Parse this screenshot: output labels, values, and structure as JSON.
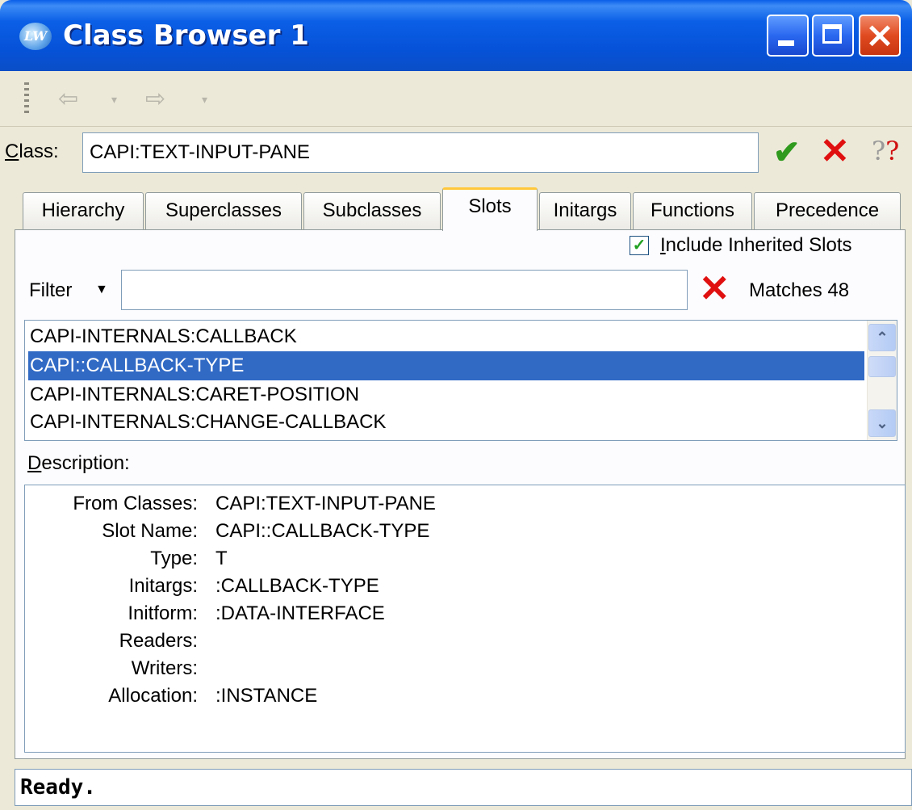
{
  "window": {
    "title": "Class Browser 1",
    "app_icon": "lw-icon",
    "controls": {
      "minimize": "minimize-icon",
      "maximize": "maximize-icon",
      "close": "close-icon"
    }
  },
  "toolbar": {
    "back": "back-arrow-icon",
    "forward": "forward-arrow-icon"
  },
  "class_row": {
    "label_prefix": "C",
    "label_rest": "lass:",
    "value": "CAPI:TEXT-INPUT-PANE",
    "ok": "✔",
    "cancel": "✕",
    "help": "?"
  },
  "tabs": [
    {
      "label": "Hierarchy",
      "active": false
    },
    {
      "label": "Superclasses",
      "active": false
    },
    {
      "label": "Subclasses",
      "active": false
    },
    {
      "label": "Slots",
      "active": true
    },
    {
      "label": "Initargs",
      "active": false
    },
    {
      "label": "Functions",
      "active": false
    },
    {
      "label": "Precedence",
      "active": false
    }
  ],
  "slots": {
    "include_inherited": {
      "checked": true,
      "label_prefix": "I",
      "label_rest": "nclude Inherited Slots"
    },
    "filter": {
      "label": "Filter",
      "value": "",
      "matches": "Matches 48"
    },
    "items": [
      {
        "text": "CAPI-INTERNALS:CALLBACK",
        "selected": false
      },
      {
        "text": "CAPI::CALLBACK-TYPE",
        "selected": true
      },
      {
        "text": "CAPI-INTERNALS:CARET-POSITION",
        "selected": false
      },
      {
        "text": "CAPI-INTERNALS:CHANGE-CALLBACK",
        "selected": false
      }
    ],
    "description_label_prefix": "D",
    "description_label_rest": "escription:",
    "description": [
      {
        "key": "From Classes:",
        "value": "CAPI:TEXT-INPUT-PANE"
      },
      {
        "key": "Slot Name:",
        "value": "CAPI::CALLBACK-TYPE"
      },
      {
        "key": "Type:",
        "value": "T"
      },
      {
        "key": "Initargs:",
        "value": ":CALLBACK-TYPE"
      },
      {
        "key": "Initform:",
        "value": ":DATA-INTERFACE"
      },
      {
        "key": "Readers:",
        "value": ""
      },
      {
        "key": "Writers:",
        "value": ""
      },
      {
        "key": "Allocation:",
        "value": ":INSTANCE"
      }
    ]
  },
  "status": {
    "text": "Ready."
  },
  "colors": {
    "titlebar": "#0b5fe6",
    "selection": "#316ac5",
    "active_tab_accent": "#ffc83c",
    "ok": "#2f9a1e",
    "cancel": "#e01010"
  }
}
